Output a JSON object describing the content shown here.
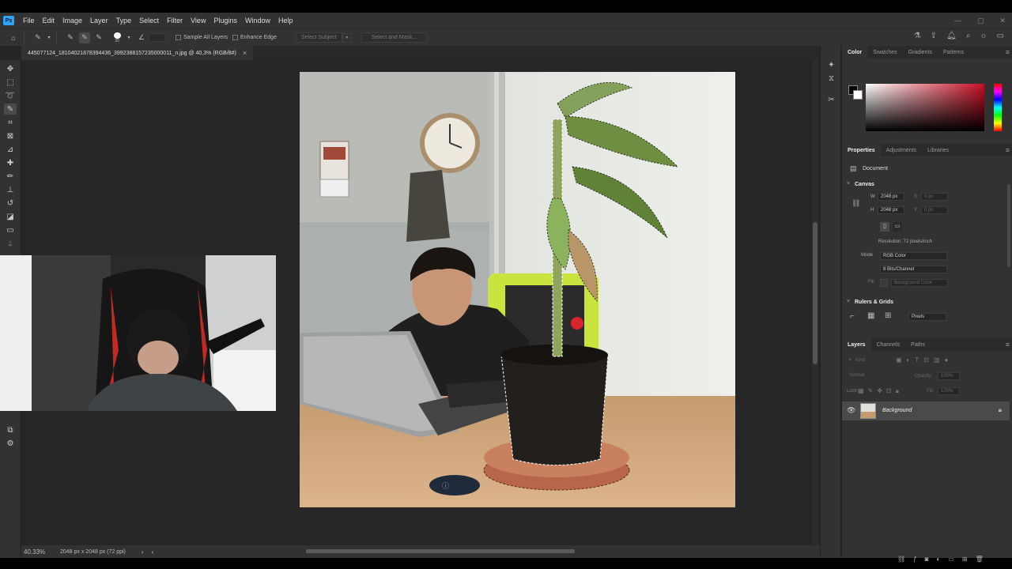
{
  "menubar": {
    "logo": "Ps",
    "items": [
      "File",
      "Edit",
      "Image",
      "Layer",
      "Type",
      "Select",
      "Filter",
      "View",
      "Plugins",
      "Window",
      "Help"
    ],
    "win_min": "—",
    "win_max": "▢",
    "win_close": "✕"
  },
  "options": {
    "brush_size": "30",
    "sample_all_layers": "Sample All Layers",
    "enhance_edge": "Enhance Edge",
    "select_subject": "Select Subject",
    "select_and_mask": "Select and Mask..."
  },
  "document": {
    "tab_title": "445077124_18104021878394436_3992388157235000011_n.jpg @ 40,3% (RGB/8#)",
    "tab_close": "×"
  },
  "status": {
    "zoom": "40.33%",
    "doc_info": "2048 px x 2048 px (72 ppi)"
  },
  "color_panel": {
    "tabs": [
      "Color",
      "Swatches",
      "Gradients",
      "Patterns"
    ],
    "active": "Color",
    "hue_color": "#c80f24"
  },
  "properties": {
    "tabs": [
      "Properties",
      "Adjustments",
      "Libraries"
    ],
    "doc_label": "Document",
    "canvas_header": "Canvas",
    "w_label": "W",
    "w_value": "2048 px",
    "h_label": "H",
    "h_value": "2048 px",
    "x_label": "X",
    "x_value": "0 px",
    "y_label": "Y",
    "y_value": "0 px",
    "resolution": "Resolution: 72 pixels/inch",
    "mode_label": "Mode",
    "mode_value": "RGB Color",
    "bits_value": "8 Bits/Channel",
    "fill_label": "Fill",
    "fill_value": "Background Color",
    "rulers_header": "Rulers & Grids",
    "units_value": "Pixels"
  },
  "layers": {
    "tabs": [
      "Layers",
      "Channels",
      "Paths"
    ],
    "kind_placeholder": "Kind",
    "blend_mode": "Normal",
    "opacity_label": "Opacity:",
    "opacity_value": "100%",
    "lock_label": "Lock:",
    "fill_label": "Fill:",
    "fill_value": "100%",
    "layer_name": "Background"
  }
}
